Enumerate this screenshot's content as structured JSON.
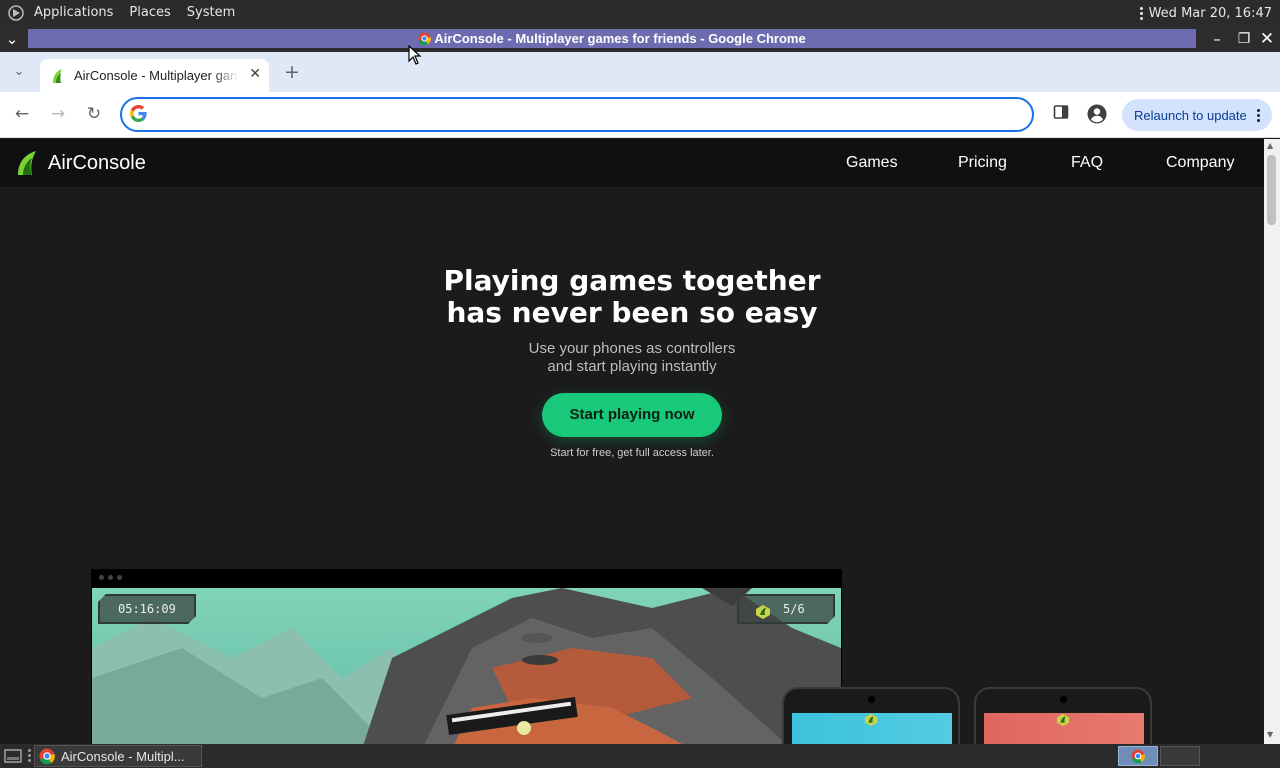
{
  "top_panel": {
    "menus": [
      "Applications",
      "Places",
      "System"
    ],
    "clock": "Wed Mar 20, 16:47"
  },
  "window": {
    "title": "AirConsole - Multiplayer games for friends - Google Chrome"
  },
  "browser": {
    "tab_title": "AirConsole - Multiplayer games for friends",
    "omnibox_value": "",
    "relaunch_label": "Relaunch to update"
  },
  "site": {
    "brand": "AirConsole",
    "nav": [
      "Games",
      "Pricing",
      "FAQ",
      "Company"
    ],
    "hero_title_line1": "Playing games together",
    "hero_title_line2": "has never been so easy",
    "hero_sub_line1": "Use your phones as controllers",
    "hero_sub_line2": "and start playing instantly",
    "cta_label": "Start playing now",
    "cta_note": "Start for free, get full access later.",
    "game_timer": "05:16:09",
    "game_score": "5/6"
  },
  "taskbar": {
    "task_label": "AirConsole - Multipl..."
  },
  "colors": {
    "accent_green": "#18c97a",
    "title_bar": "#6e6cb0",
    "omnibox_focus": "#1a73e8"
  }
}
